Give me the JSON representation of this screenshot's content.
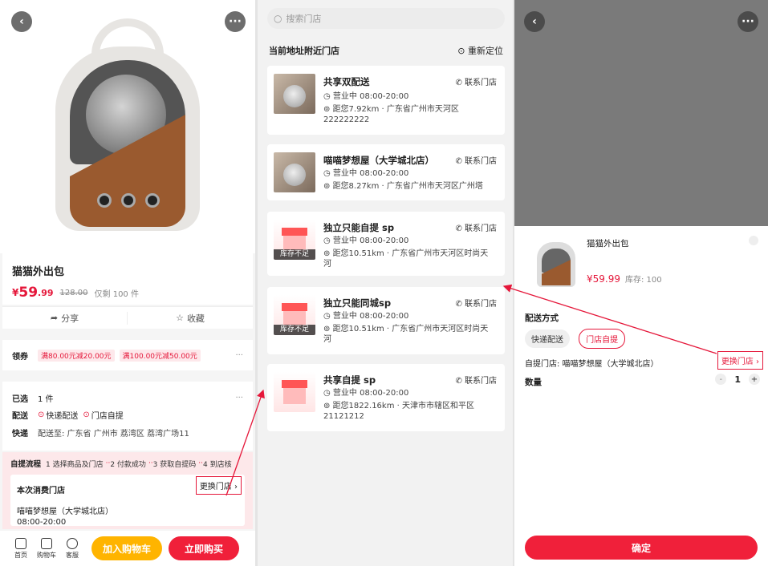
{
  "product": {
    "name": "猫猫外出包",
    "price_symbol": "¥",
    "price": "59",
    "price_decimal": ".99",
    "original_price": "128.00",
    "remaining": "仅剩 100 件",
    "share": "分享",
    "favorite": "收藏"
  },
  "coupon": {
    "label": "领券",
    "tags": [
      "满80.00元减20.00元",
      "满100.00元减50.00元"
    ],
    "more": "···"
  },
  "selection": {
    "selected_label": "已选",
    "selected_value": "1 件",
    "more": "···",
    "delivery_label": "配送",
    "delivery_opt1": "快递配送",
    "delivery_opt2": "门店自提",
    "ship_label": "快递",
    "ship_value": "配送至: 广东省 广州市 荔湾区 荔湾广场11"
  },
  "pickup_flow": {
    "label": "自提流程",
    "steps": [
      "1 选择商品及门店",
      "2 付款成功",
      "3 获取自提码",
      "4 到店核"
    ]
  },
  "store_card": {
    "title": "本次消费门店",
    "change": "更换门店",
    "name": "喵喵梦想屋（大学城北店）",
    "hours": "08:00-20:00"
  },
  "bottom_bar": {
    "home": "首页",
    "cart": "购物车",
    "service": "客服",
    "add_cart": "加入购物车",
    "buy_now": "立即购买"
  },
  "store_list": {
    "search_placeholder": "搜索门店",
    "header": "当前地址附近门店",
    "relocate": "重新定位",
    "contact": "联系门店",
    "stores": [
      {
        "name": "共享双配送",
        "hours": "营业中 08:00-20:00",
        "distance": "距您7.92km",
        "address": "广东省广州市天河区",
        "address2": "222222222",
        "stock": ""
      },
      {
        "name": "喵喵梦想屋（大学城北店）",
        "hours": "营业中 08:00-20:00",
        "distance": "距您8.27km",
        "address": "广东省广州市天河区广州塔",
        "address2": "",
        "stock": ""
      },
      {
        "name": "独立只能自提 sp",
        "hours": "营业中 08:00-20:00",
        "distance": "距您10.51km",
        "address": "广东省广州市天河区时尚天",
        "address2": "河",
        "stock": "库存不足"
      },
      {
        "name": "独立只能同城sp",
        "hours": "营业中 08:00-20:00",
        "distance": "距您10.51km",
        "address": "广东省广州市天河区时尚天",
        "address2": "河",
        "stock": "库存不足"
      },
      {
        "name": "共享自提 sp",
        "hours": "营业中 08:00-20:00",
        "distance": "距您1822.16km",
        "address": "天津市市辖区和平区",
        "address2": "21121212",
        "stock": ""
      }
    ]
  },
  "sheet": {
    "product_name": "猫猫外出包",
    "price": "¥59.99",
    "stock": "库存: 100",
    "delivery_title": "配送方式",
    "opt_express": "快递配送",
    "opt_pickup": "门店自提",
    "pickup_store": "自提门店: 喵喵梦想屋（大学城北店）",
    "change": "更换门店",
    "qty_label": "数量",
    "qty": "1",
    "minus": "-",
    "plus": "+",
    "confirm": "确定"
  },
  "colors": {
    "accent": "#e5173a",
    "yellow": "#ffb400"
  }
}
